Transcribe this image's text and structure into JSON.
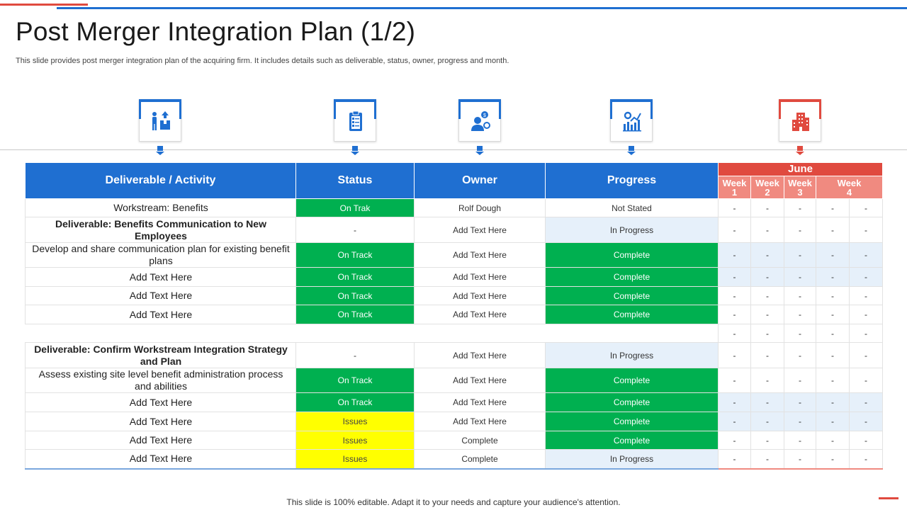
{
  "title": "Post Merger Integration Plan (1/2)",
  "subtitle": "This slide provides post merger integration plan of the acquiring firm. It includes details such as deliverable, status, owner, progress and month.",
  "colors": {
    "blue": "#1f6fd1",
    "red": "#e04a3f",
    "salmon": "#f08a80",
    "green": "#00b050",
    "yellow": "#ffff00",
    "lightblue": "#e6f0fa"
  },
  "icons": [
    "delivery-person-icon",
    "clipboard-checklist-icon",
    "owner-person-icon",
    "progress-chart-icon",
    "calendar-building-icon"
  ],
  "headers": {
    "activity": "Deliverable / Activity",
    "status": "Status",
    "owner": "Owner",
    "progress": "Progress",
    "month": "June",
    "weeks": [
      "Week\n1",
      "Week\n2",
      "Week\n3",
      "Week\n4"
    ]
  },
  "rows": [
    {
      "activity": "Workstream: Benefits",
      "bold": false,
      "status": "On Trak",
      "owner": "Rolf Dough",
      "progress": "Not Stated"
    },
    {
      "activity": "Deliverable: Benefits Communication to New Employees",
      "bold": true,
      "status": "-",
      "owner": "Add Text Here",
      "progress": "In Progress"
    },
    {
      "activity": "Develop and share communication plan for existing benefit plans",
      "bold": false,
      "status": "On Track",
      "owner": "Add Text Here",
      "progress": "Complete"
    },
    {
      "activity": "Add Text Here",
      "bold": false,
      "status": "On Track",
      "owner": "Add Text Here",
      "progress": "Complete"
    },
    {
      "activity": "Add Text Here",
      "bold": false,
      "status": "On Track",
      "owner": "Add Text Here",
      "progress": "Complete"
    },
    {
      "activity": "Add Text Here",
      "bold": false,
      "status": "On Track",
      "owner": "Add Text Here",
      "progress": "Complete"
    },
    {
      "activity": "",
      "bold": false,
      "status": "",
      "owner": "",
      "progress": ""
    },
    {
      "activity": "Deliverable: Confirm Workstream Integration Strategy and Plan",
      "bold": true,
      "status": "-",
      "owner": "Add Text Here",
      "progress": "In Progress"
    },
    {
      "activity": "Assess existing site level benefit administration process and abilities",
      "bold": false,
      "status": "On Track",
      "owner": "Add Text Here",
      "progress": "Complete"
    },
    {
      "activity": "Add Text Here",
      "bold": false,
      "status": "On Track",
      "owner": "Add Text Here",
      "progress": "Complete"
    },
    {
      "activity": "Add Text Here",
      "bold": false,
      "status": "Issues",
      "owner": "Add Text Here",
      "progress": "Complete"
    },
    {
      "activity": "Add Text Here",
      "bold": false,
      "status": "Issues",
      "owner": "Complete",
      "progress": "Complete"
    },
    {
      "activity": "Add Text Here",
      "bold": false,
      "status": "Issues",
      "owner": "Complete",
      "progress": "In Progress"
    }
  ],
  "week_cell": "-",
  "footer": "This slide is 100% editable. Adapt it to your needs and capture your audience's attention."
}
